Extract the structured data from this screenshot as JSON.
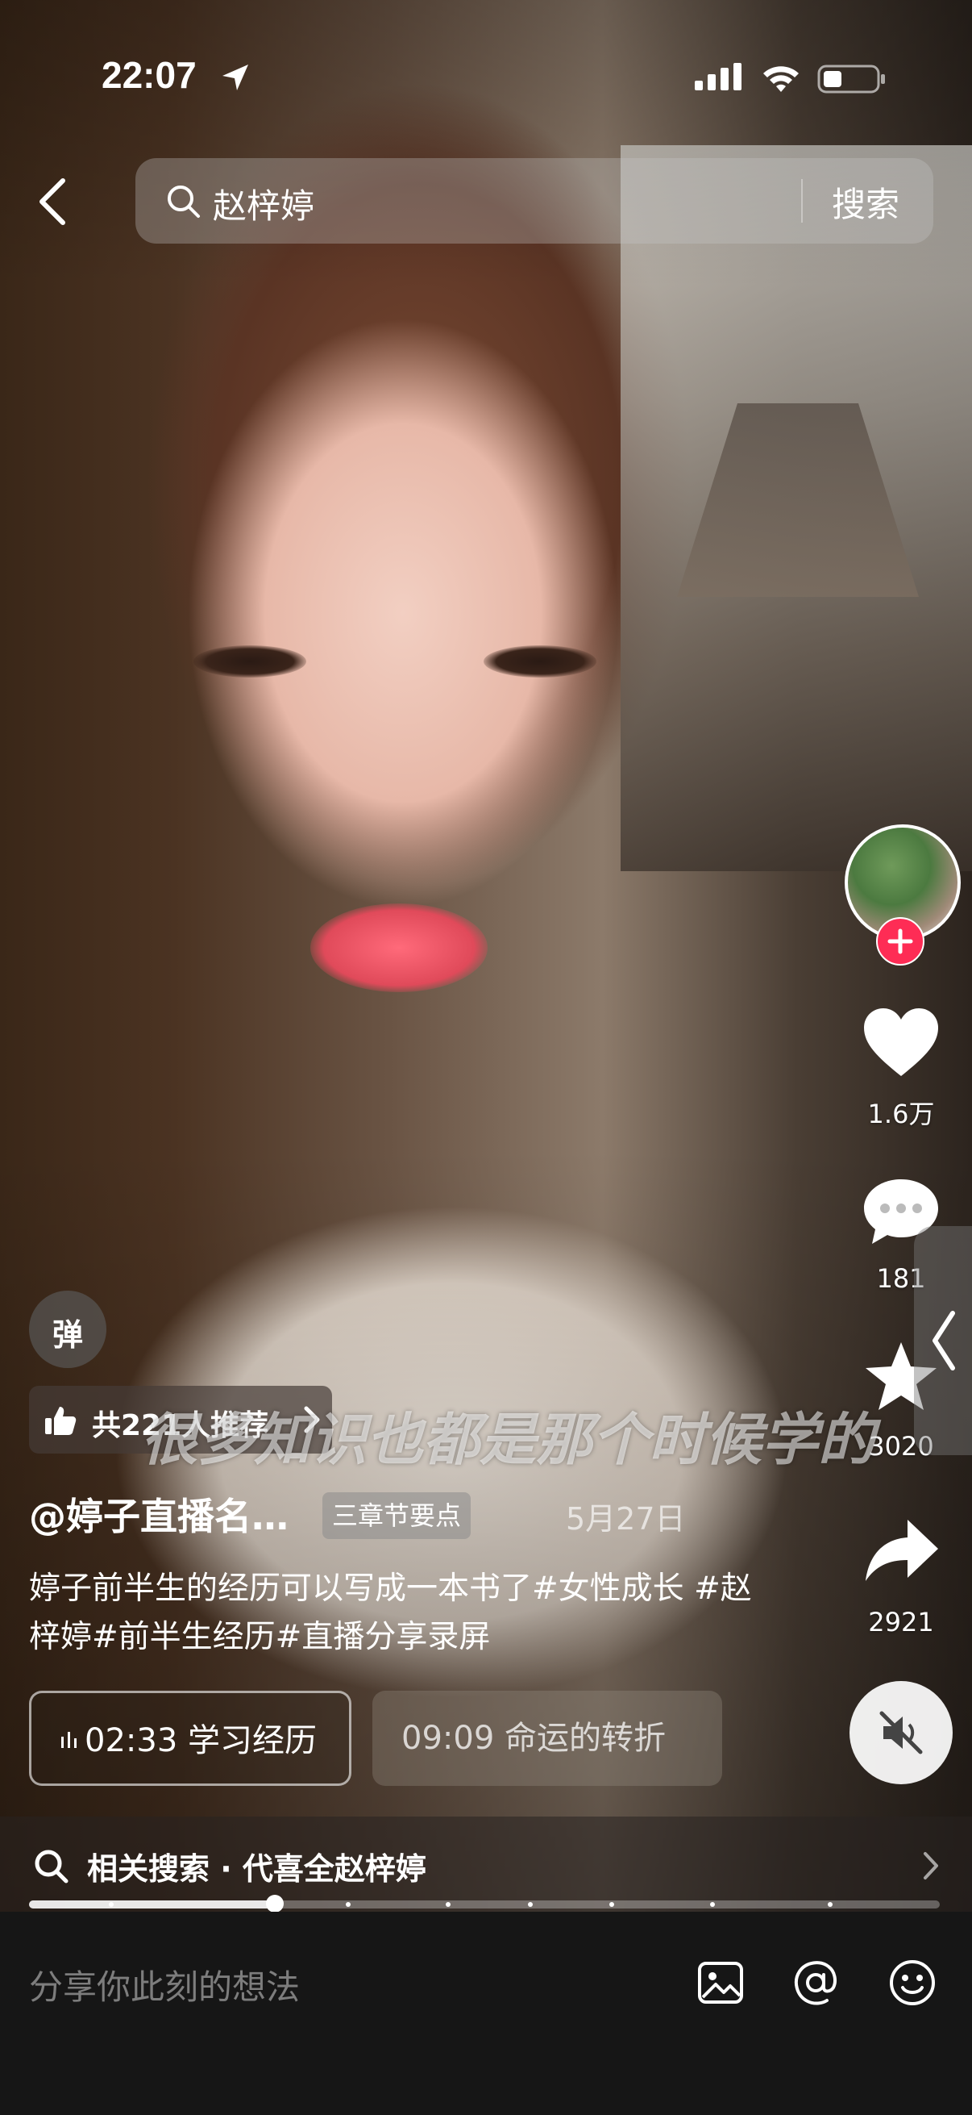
{
  "status": {
    "time": "22:07"
  },
  "search": {
    "query": "赵梓婷",
    "button_label": "搜索"
  },
  "actions": {
    "likes": "1.6万",
    "comments": "181",
    "favorites": "3020",
    "shares": "2921"
  },
  "overlay": {
    "danmu_label": "弹",
    "recommend": "共221人推荐",
    "subtitle": "很多知识也都是那个时候学的"
  },
  "post": {
    "author": "@婷子直播名…",
    "chapter_tag": "三章节要点",
    "date": "5月27日",
    "description": "婷子前半生的经历可以写成一本书了#女性成长 #赵梓婷#前半生经历#直播分享录屏"
  },
  "chapters": [
    {
      "time": "02:33",
      "title": "学习经历",
      "active": true
    },
    {
      "time": "09:09",
      "title": "命运的转折",
      "active": false
    }
  ],
  "related": {
    "text": "相关搜索 · 代喜全赵梓婷"
  },
  "playback": {
    "progress_fraction": 0.27,
    "chapter_markers": [
      0.09,
      0.27,
      0.35,
      0.46,
      0.55,
      0.64,
      0.75,
      0.88
    ]
  },
  "comment_bar": {
    "placeholder": "分享你此刻的想法"
  },
  "icons": [
    "location-arrow-icon",
    "signal-icon",
    "wifi-icon",
    "battery-icon",
    "back-icon",
    "search-icon",
    "plus-icon",
    "heart-icon",
    "comment-icon",
    "star-icon",
    "share-icon",
    "chevron-left-icon",
    "mute-icon",
    "thumbs-up-icon",
    "chevron-right-icon",
    "image-icon",
    "at-icon",
    "emoji-icon"
  ],
  "colors": {
    "accent_red": "#fe2c55",
    "bottom_bar": "#161616"
  }
}
